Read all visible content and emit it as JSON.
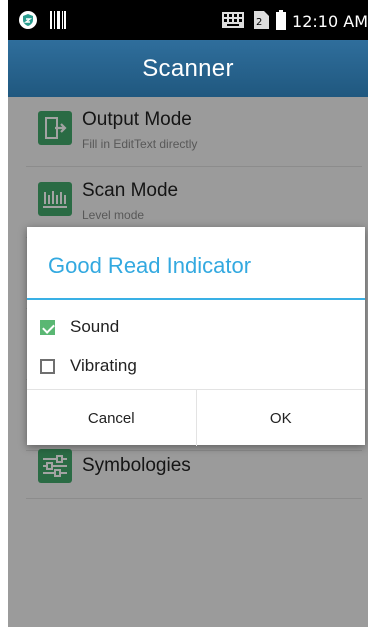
{
  "status_bar": {
    "time": "12:10 AM",
    "left_icons": [
      "shield-app-icon",
      "barcode-icon"
    ],
    "right_icons": [
      "keyboard-icon",
      "sim-icon",
      "battery-icon"
    ]
  },
  "action_bar": {
    "title": "Scanner"
  },
  "preferences": [
    {
      "title": "Output Mode",
      "summary": "Fill in EditText directly",
      "icon": "output-icon"
    },
    {
      "title": "Scan Mode",
      "summary": "Level mode",
      "icon": "scan-icon"
    },
    {
      "title": "Symbologies",
      "summary": "",
      "icon": "sliders-icon"
    }
  ],
  "dialog": {
    "title": "Good Read Indicator",
    "options": [
      {
        "label": "Sound",
        "checked": true
      },
      {
        "label": "Vibrating",
        "checked": false
      }
    ],
    "buttons": {
      "cancel": "Cancel",
      "ok": "OK"
    }
  },
  "colors": {
    "action_bar": "#2a6590",
    "accent": "#33a9e0",
    "icon_green": "#43a86b",
    "checkbox_green": "#5ab773"
  }
}
